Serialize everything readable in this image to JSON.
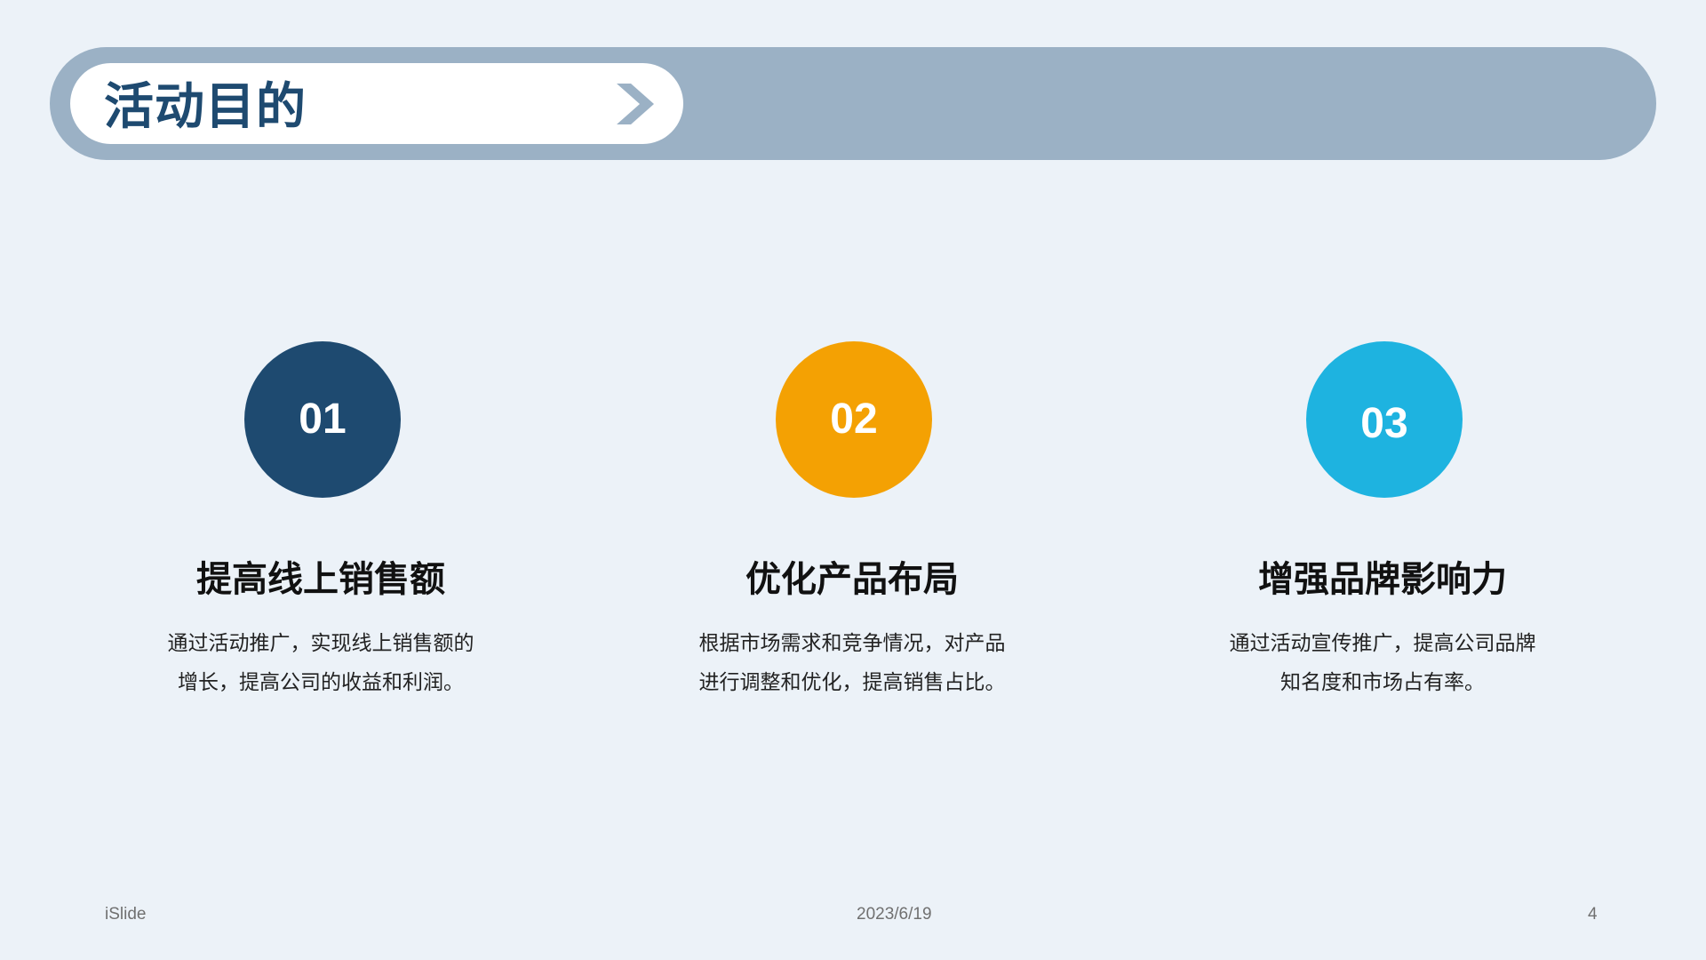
{
  "header": {
    "title": "活动目的",
    "chevron_icon": "chevron-right-icon"
  },
  "colors": {
    "header_bar": "#9BB1C5",
    "title_text": "#1E4A70",
    "circle_1": "#1E4A70",
    "circle_2": "#F4A103",
    "circle_3": "#1EB3E0",
    "background": "#ECF2F8"
  },
  "items": [
    {
      "number": "01",
      "heading": "提高线上销售额",
      "desc_lines": [
        "通过活动推广，实现线上销售额的",
        "增长，提高公司的收益和利润。"
      ]
    },
    {
      "number": "02",
      "heading": "优化产品布局",
      "desc_lines": [
        "根据市场需求和竞争情况，对产品",
        "进行调整和优化，提高销售占比。"
      ]
    },
    {
      "number": "03",
      "heading": "增强品牌影响力",
      "desc_lines": [
        "通过活动宣传推广，提高公司品牌",
        "知名度和市场占有率。"
      ]
    }
  ],
  "footer": {
    "left": "iSlide",
    "center": "2023/6/19",
    "page_number": "4"
  }
}
